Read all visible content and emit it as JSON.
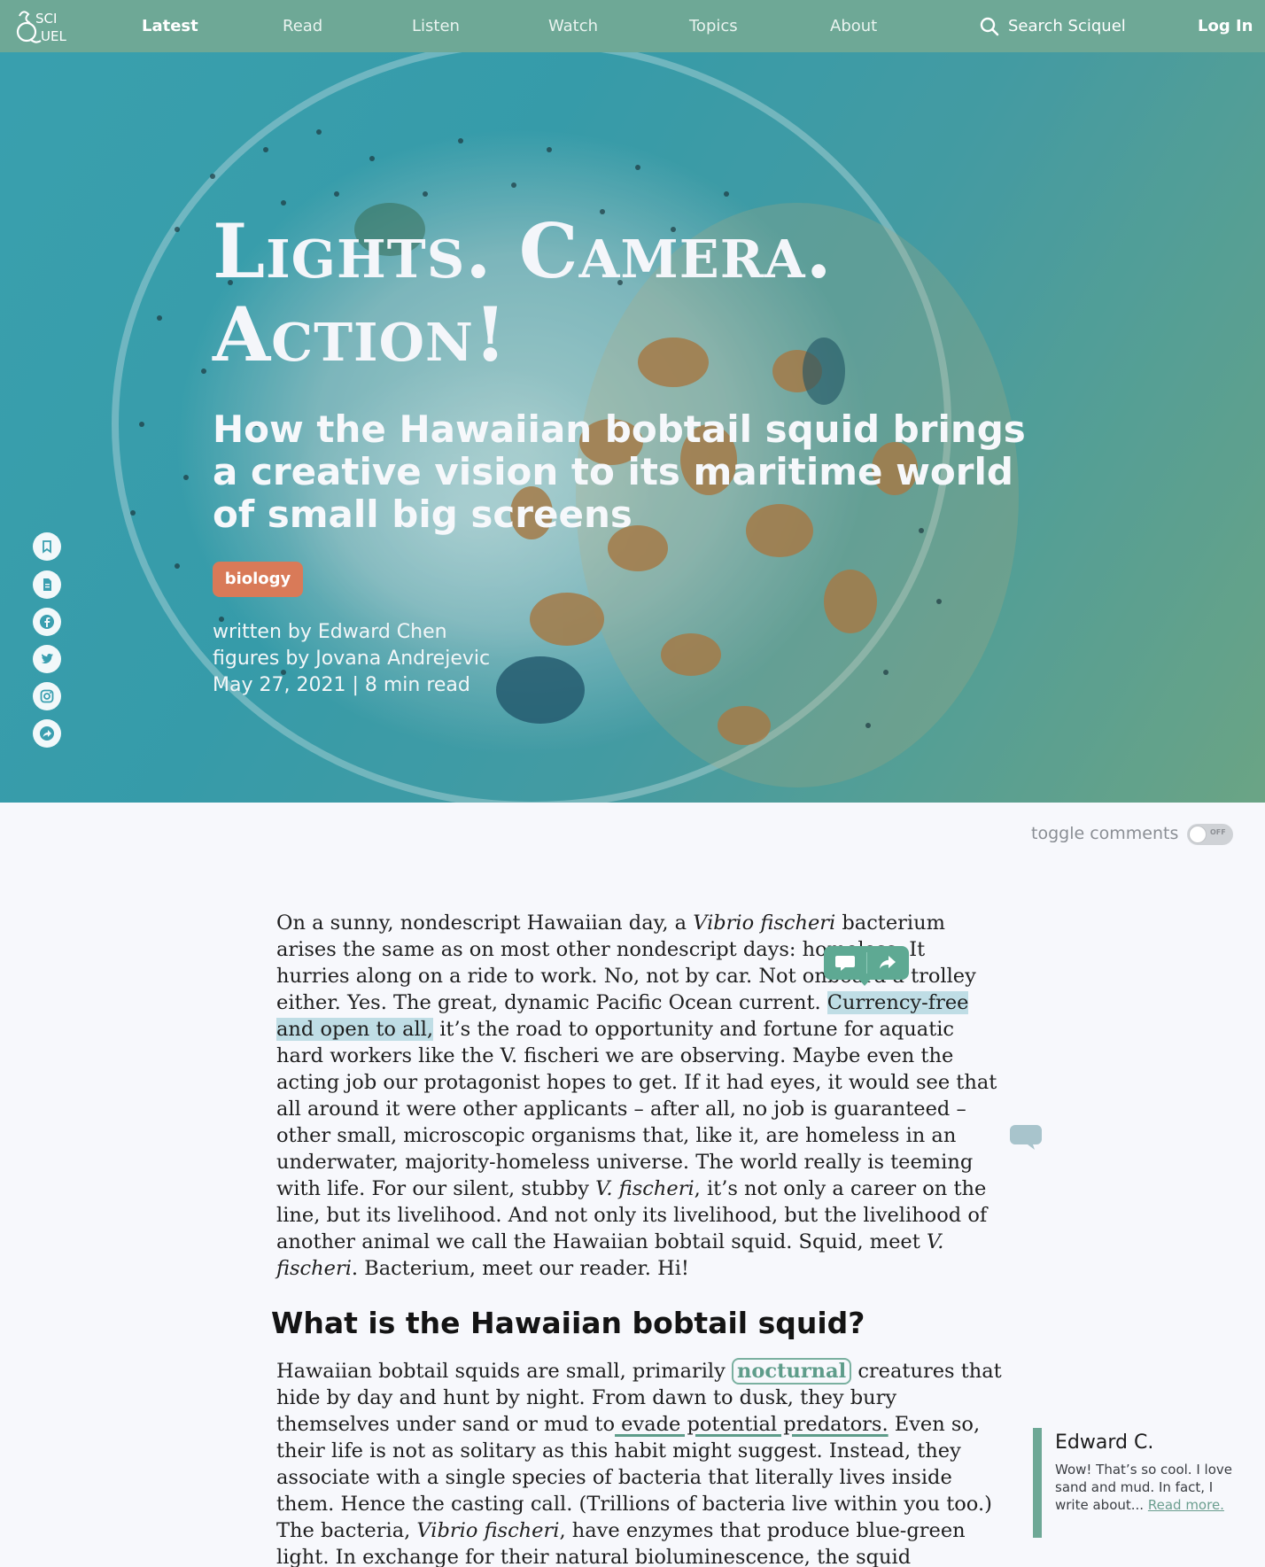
{
  "nav": {
    "logo_top": "SCI",
    "logo_bottom": "UEL",
    "links": [
      "Latest",
      "Read",
      "Listen",
      "Watch",
      "Topics",
      "About"
    ],
    "search_label": "Search Sciquel",
    "login_label": "Log In"
  },
  "hero": {
    "title_line1": "Lights. Camera.",
    "title_line2": "Action!",
    "subtitle": "How the Hawaiian bobtail squid brings a creative vision to its maritime world of small big screens",
    "tag": "biology",
    "author": "written by Edward Chen",
    "figures": "figures by Jovana Andrejevic",
    "date_read": "May 27, 2021 | 8 min read",
    "social_icons": [
      "bookmark-icon",
      "document-icon",
      "facebook-icon",
      "twitter-icon",
      "instagram-icon",
      "share-icon"
    ]
  },
  "comments_toggle": {
    "label": "toggle comments",
    "state": "OFF"
  },
  "article": {
    "p1_a": "On a sunny, nondescript Hawaiian day, a ",
    "p1_b": "Vibrio fischeri",
    "p1_c": " bacterium arises the same as on most other nondescript days: homeless. It hurries along on a ride to work. No, not by car. Not onboard a trolley either. Yes. The great, dynamic Pacific Ocean current. ",
    "p1_hl": "Currency-free and open to all,",
    "p1_d": " it’s the road to opportunity and fortune for aquatic hard workers like the V. fischeri we are observing. Maybe even the acting job our protagonist hopes to get. If it had eyes, it would see that all around it were other applicants – after all, no job is guaranteed – other small, microscopic organisms that, like it, are homeless in an underwater, majority-homeless universe. The world really is teeming with life. For our silent, stubby ",
    "p1_e": "V. fischeri",
    "p1_f": ", it’s not only a career on the line, but its livelihood. And not only its livelihood, but the livelihood of another animal we call the Hawaiian bobtail squid. Squid, meet ",
    "p1_g": "V. fischeri",
    "p1_h": ". Bacterium, meet our reader. Hi!",
    "h2": "What is the Hawaiian bobtail squid?",
    "p2_a": "Hawaiian bobtail squids are small, primarily ",
    "p2_gloss": "nocturnal",
    "p2_b": " creatures that hide by day and hunt by night. From dawn to dusk, they bury themselves under sand or mud to",
    "p2_ul": " evade potential predators.",
    "p2_c": " Even so, their life is not as solitary as this habit might suggest. Instead, they associate with a single species of bacteria that literally lives inside them. Hence the casting call. (Trillions of bacteria live within you too.) The bacteria, ",
    "p2_d": "Vibrio fischeri",
    "p2_e": ", have enzymes that produce blue-green light. In exchange for their natural bioluminescence, the squid provides nutrients such as sugars and amino acids for the"
  },
  "comment_card": {
    "name": "Edward C.",
    "text": "Wow! That’s so cool. I love sand and mud. In fact, I write about...",
    "more": "Read more."
  },
  "colors": {
    "nav_bg": "#6ea896",
    "tag_bg": "#d97a58",
    "highlight": "#bfdde5",
    "accent": "#5e9c8a"
  }
}
